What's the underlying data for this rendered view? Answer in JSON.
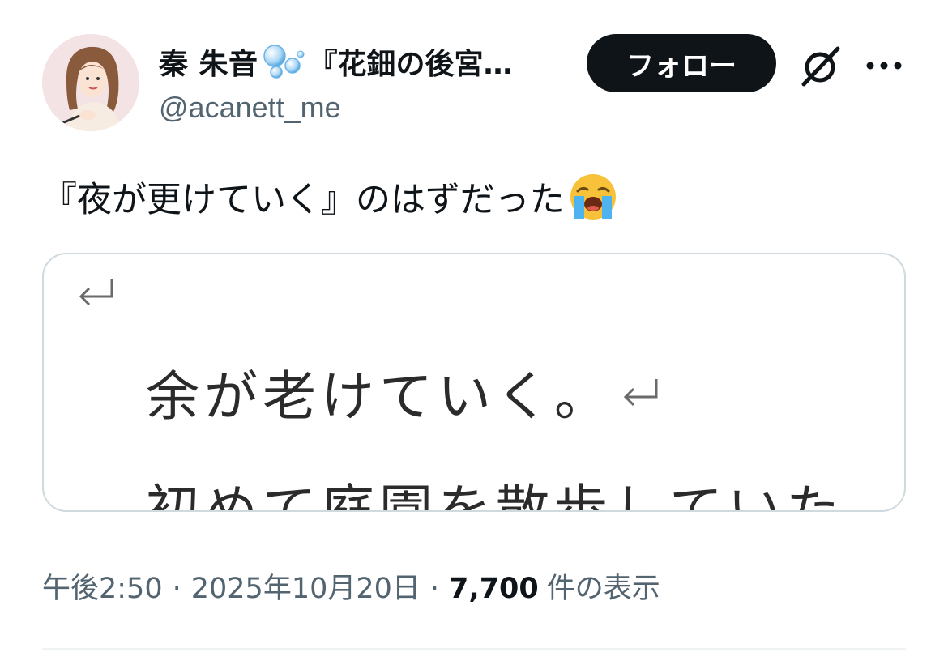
{
  "header": {
    "display_name": "秦 朱音",
    "book_title": "『花鈿の後宮…",
    "handle": "@acanett_me",
    "follow_label": "フォロー",
    "bubbles_icon": "bubbles-emoji-icon",
    "grok_icon": "grok-icon",
    "more_icon": "more-icon"
  },
  "tweet": {
    "text": "『夜が更けていく』のはずだった",
    "emoji": "loudly-crying-face-icon"
  },
  "media": {
    "line1": "余が老けていく。",
    "line2": "初めて庭園を散歩していた",
    "return_icon": "return-arrow-icon"
  },
  "meta": {
    "time": "午後2:50",
    "separator": "·",
    "date": "2025年10月20日",
    "views": "7,700",
    "views_label": "件の表示"
  },
  "colors": {
    "text_primary": "#0f1419",
    "text_secondary": "#536471",
    "follow_bg": "#0f1419",
    "border": "#cfd9de"
  }
}
